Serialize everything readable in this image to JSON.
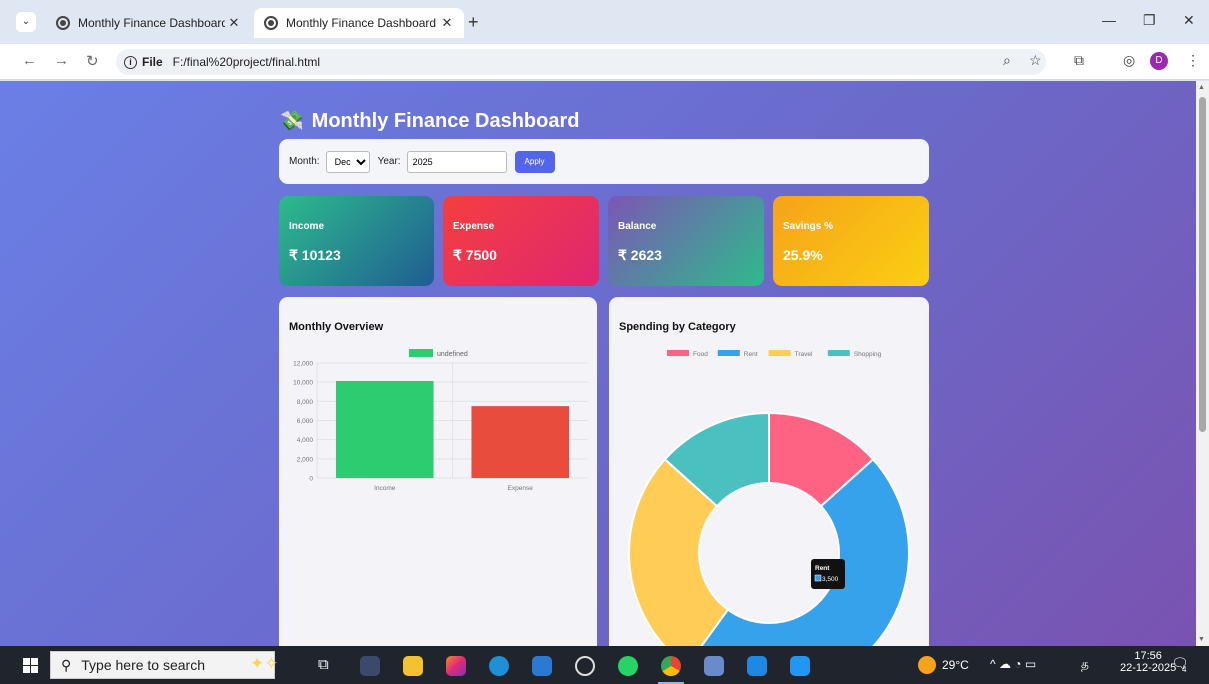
{
  "browser": {
    "tabs": [
      {
        "title": "Monthly Finance Dashboard",
        "active": false
      },
      {
        "title": "Monthly Finance Dashboard",
        "active": true
      }
    ],
    "new_tab": "+",
    "url_scheme": "File",
    "url": "F:/final%20project/final.html",
    "profile_initial": "D"
  },
  "dashboard": {
    "title": "Monthly Finance Dashboard",
    "title_icon": "money-with-wings-icon",
    "filters": {
      "month_label": "Month:",
      "month_value": "Dec",
      "year_label": "Year:",
      "year_value": "2025",
      "apply_label": "Apply"
    },
    "cards": {
      "income": {
        "label": "Income",
        "value": "₹ 10123"
      },
      "expense": {
        "label": "Expense",
        "value": "₹ 7500"
      },
      "balance": {
        "label": "Balance",
        "value": "₹ 2623"
      },
      "savings": {
        "label": "Savings %",
        "value": "25.9%"
      }
    },
    "overview_title": "Monthly Overview",
    "category_title": "Spending by Category"
  },
  "chart_data": [
    {
      "type": "bar",
      "title": "Monthly Overview",
      "categories": [
        "Income",
        "Expense"
      ],
      "values": [
        10123,
        7500
      ],
      "series_legend": "undefined",
      "colors": [
        "#2ecc71",
        "#e74c3c"
      ],
      "legend_color": "#2ecc71",
      "ylim": [
        0,
        12000
      ],
      "yticks": [
        "12,000",
        "10,000",
        "8,000",
        "6,000",
        "4,000",
        "2,000",
        "0"
      ],
      "grid": true,
      "legend_position": "top"
    },
    {
      "type": "pie",
      "title": "Spending by Category",
      "categories": [
        "Food",
        "Rent",
        "Travel",
        "Shopping"
      ],
      "values": [
        1000,
        3500,
        2000,
        1000
      ],
      "colors": [
        "#ff6384",
        "#36a2eb",
        "#ffcd56",
        "#4bc0c0"
      ],
      "donut": true,
      "legend_position": "top",
      "tooltip": {
        "label": "Rent",
        "value": "3,500"
      }
    }
  ],
  "taskbar": {
    "search_placeholder": "Type here to search",
    "temperature": "29°C",
    "time": "17:56",
    "date": "22-12-2025",
    "notification_count": "4",
    "language": "த"
  }
}
